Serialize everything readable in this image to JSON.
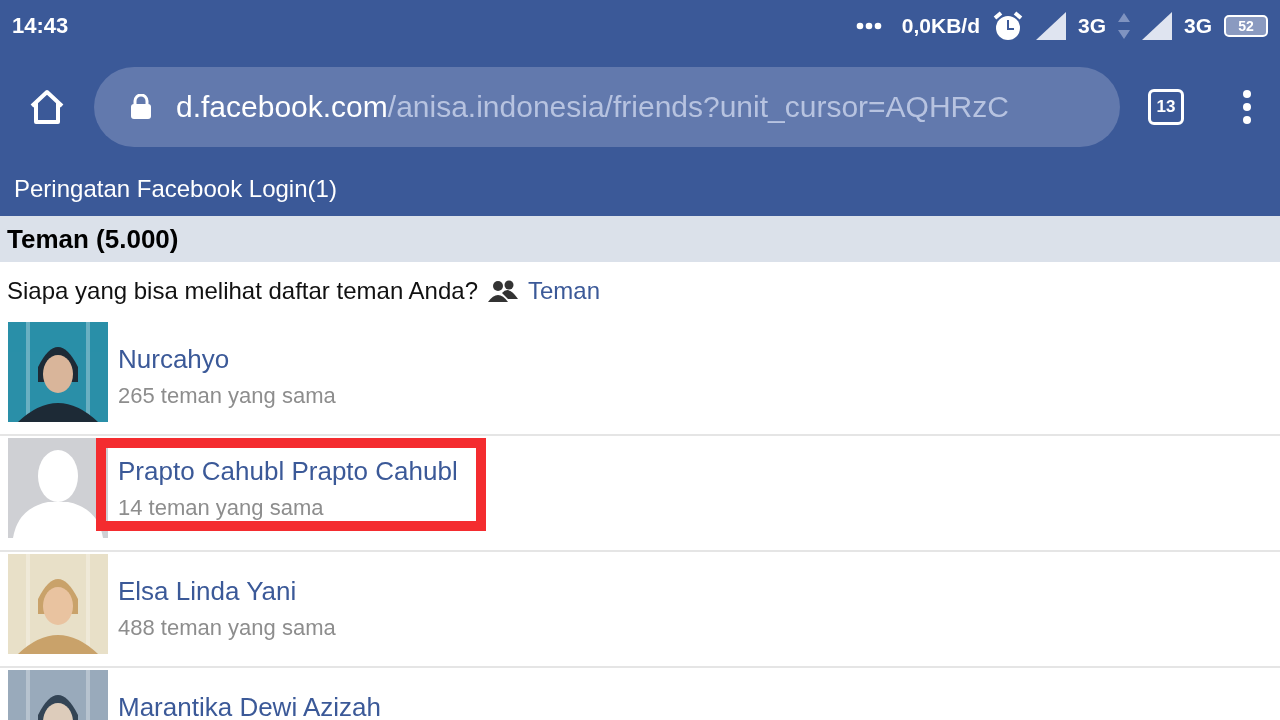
{
  "status_bar": {
    "time": "14:43",
    "data_rate": "0,0KB/d",
    "networks": [
      {
        "type": "3G",
        "activity": true
      },
      {
        "type": "3G",
        "activity": false
      }
    ],
    "battery": "52"
  },
  "browser": {
    "url_host": "d.facebook.com",
    "url_path": "/anisa.indonesia/friends?unit_cursor=AQHRzC",
    "tab_count": "13"
  },
  "notice": "Peringatan Facebook Login(1)",
  "section_title": "Teman (5.000)",
  "privacy": {
    "question": "Siapa yang bisa melihat daftar teman Anda?",
    "audience": "Teman"
  },
  "friends": [
    {
      "name": "Nurcahyo",
      "mutual": "265 teman yang sama",
      "highlighted": false
    },
    {
      "name": "Prapto Cahubl Prapto Cahubl",
      "mutual": "14 teman yang sama",
      "kind": "default",
      "highlighted": true
    },
    {
      "name": "Elsa Linda Yani",
      "mutual": "488 teman yang sama",
      "highlighted": false
    },
    {
      "name": "Marantika Dewi Azizah",
      "highlighted": false
    }
  ]
}
